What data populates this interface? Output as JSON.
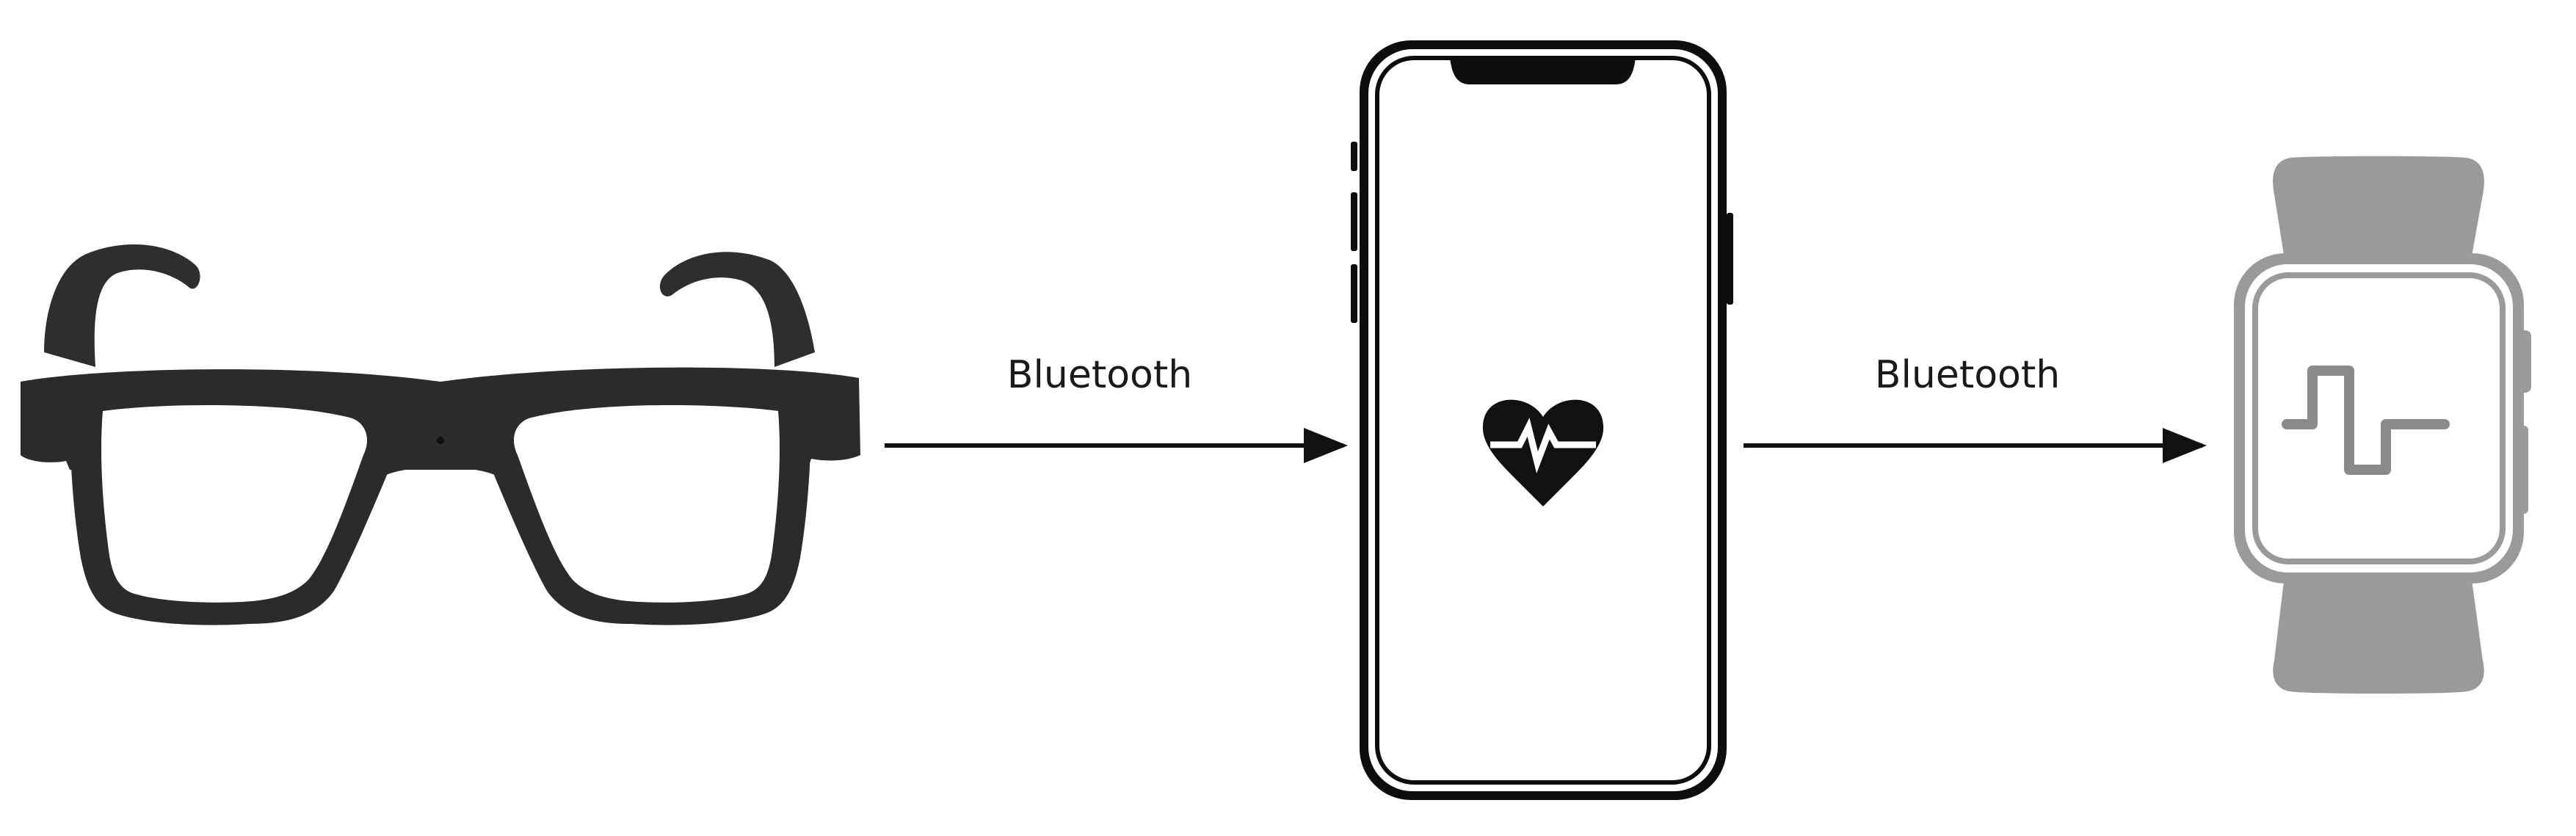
{
  "diagram": {
    "nodes": [
      {
        "id": "glasses",
        "icon": "smart-glasses-icon",
        "color": "#2b2b2b"
      },
      {
        "id": "phone",
        "icon": "smartphone-heart-rate-icon",
        "color": "#0d0d0d"
      },
      {
        "id": "watch",
        "icon": "smartwatch-signal-icon",
        "color": "#9a9a9a"
      }
    ],
    "links": [
      {
        "from": "glasses",
        "to": "phone",
        "label": "Bluetooth"
      },
      {
        "from": "phone",
        "to": "watch",
        "label": "Bluetooth"
      }
    ],
    "arrow_color": "#111111"
  }
}
